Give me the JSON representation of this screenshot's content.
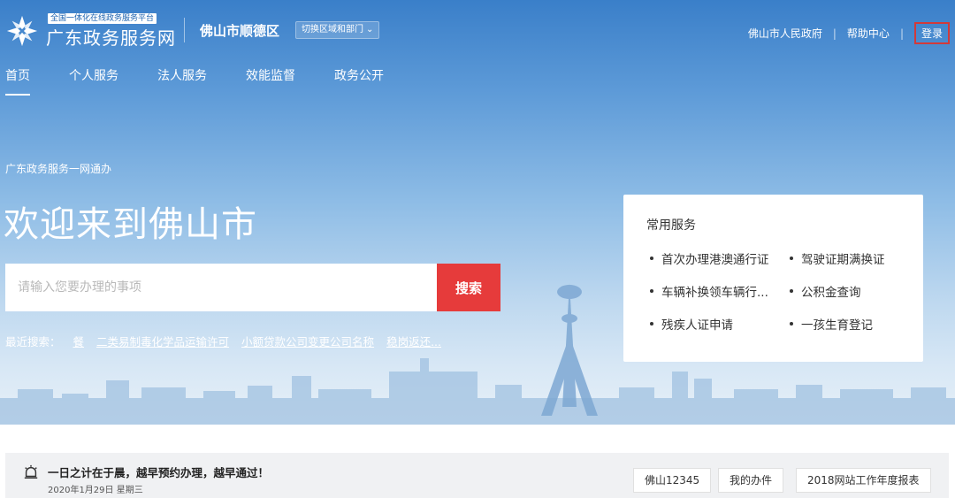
{
  "header": {
    "platform_tag": "全国一体化在线政务服务平台",
    "site_name": "广东政务服务网",
    "region": "佛山市顺德区",
    "switch_label": "切换区域和部门",
    "links": [
      "佛山市人民政府",
      "帮助中心"
    ],
    "login": "登录"
  },
  "nav": {
    "items": [
      {
        "label": "首页"
      },
      {
        "label": "个人服务"
      },
      {
        "label": "法人服务"
      },
      {
        "label": "效能监督"
      },
      {
        "label": "政务公开"
      }
    ]
  },
  "hero": {
    "tagline": "广东政务服务一网通办",
    "welcome": "欢迎来到佛山市",
    "search_placeholder": "请输入您要办理的事项",
    "search_button": "搜索",
    "recent_label": "最近搜索：",
    "recent_items": [
      "餐",
      "二类易制毒化学品运输许可",
      "小额贷款公司变更公司名称",
      "稳岗返还..."
    ]
  },
  "services": {
    "title": "常用服务",
    "items": [
      "首次办理港澳通行证",
      "驾驶证期满换证",
      "车辆补换领车辆行...",
      "公积金查询",
      "残疾人证申请",
      "一孩生育登记"
    ]
  },
  "bottom": {
    "notice": "一日之计在于晨，越早预约办理，越早通过！",
    "date": "2020年1月29日 星期三",
    "quick_links": [
      "佛山12345",
      "我的办件",
      "2018网站工作年度报表"
    ]
  },
  "colors": {
    "primary_blue": "#3a7fc9",
    "search_red": "#e63b3b",
    "login_border": "#d23a3a"
  }
}
